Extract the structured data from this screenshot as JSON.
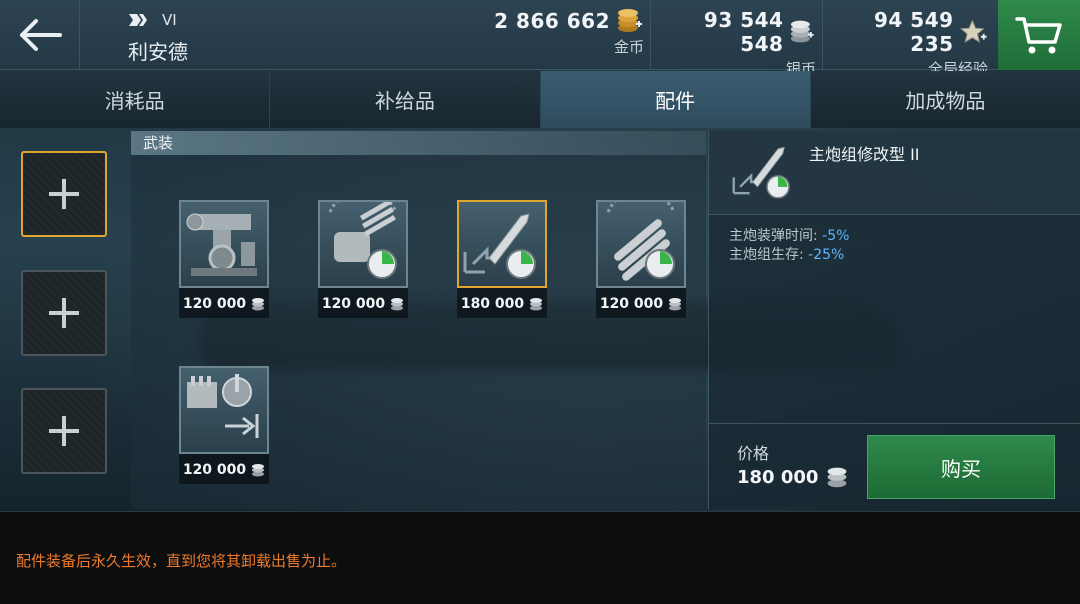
{
  "header": {
    "tier": "VI",
    "ship_name": "利安德",
    "currencies": [
      {
        "amount": "2 866 662",
        "label": "金币",
        "icon": "gold-coins-icon",
        "color": "#d9a43a"
      },
      {
        "amount": "93 544 548",
        "label": "银币",
        "icon": "silver-coins-icon",
        "color": "#c9cfd3"
      },
      {
        "amount": "94 549 235",
        "label": "全局经验",
        "icon": "star-xp-icon",
        "color": "#d6d1bd"
      }
    ]
  },
  "tabs": [
    {
      "label": "消耗品",
      "active": false
    },
    {
      "label": "补给品",
      "active": false
    },
    {
      "label": "配件",
      "active": true
    },
    {
      "label": "加成物品",
      "active": false
    }
  ],
  "slots": [
    {
      "icon": "plus-icon",
      "selected": true
    },
    {
      "icon": "plus-icon",
      "selected": false
    },
    {
      "icon": "plus-icon",
      "selected": false
    }
  ],
  "armament": {
    "title": "武装",
    "modules": [
      {
        "icon": "main-armaments-mod-icon",
        "price": "120 000",
        "selected": false
      },
      {
        "icon": "turret-reload-mod-icon",
        "price": "120 000",
        "selected": false
      },
      {
        "icon": "shell-reload-mod-icon",
        "price": "180 000",
        "selected": true
      },
      {
        "icon": "torpedo-reload-mod-icon",
        "price": "120 000",
        "selected": false
      },
      {
        "icon": "secondary-battery-mod-icon",
        "price": "120 000",
        "selected": false
      }
    ]
  },
  "detail": {
    "title": "主炮组修改型 II",
    "stats": [
      {
        "name": "主炮装弹时间:",
        "value": "-5%"
      },
      {
        "name": "主炮组生存:",
        "value": "-25%"
      }
    ],
    "price_label": "价格",
    "price_value": "180 000",
    "buy_label": "购买"
  },
  "notice": "配件装备后永久生效，直到您将其卸载出售为止。",
  "colors": {
    "accent_green": "#2f8a4b",
    "selected_border": "#e0a530",
    "stat_value": "#5fb6ff",
    "notice": "#f07a2a"
  }
}
